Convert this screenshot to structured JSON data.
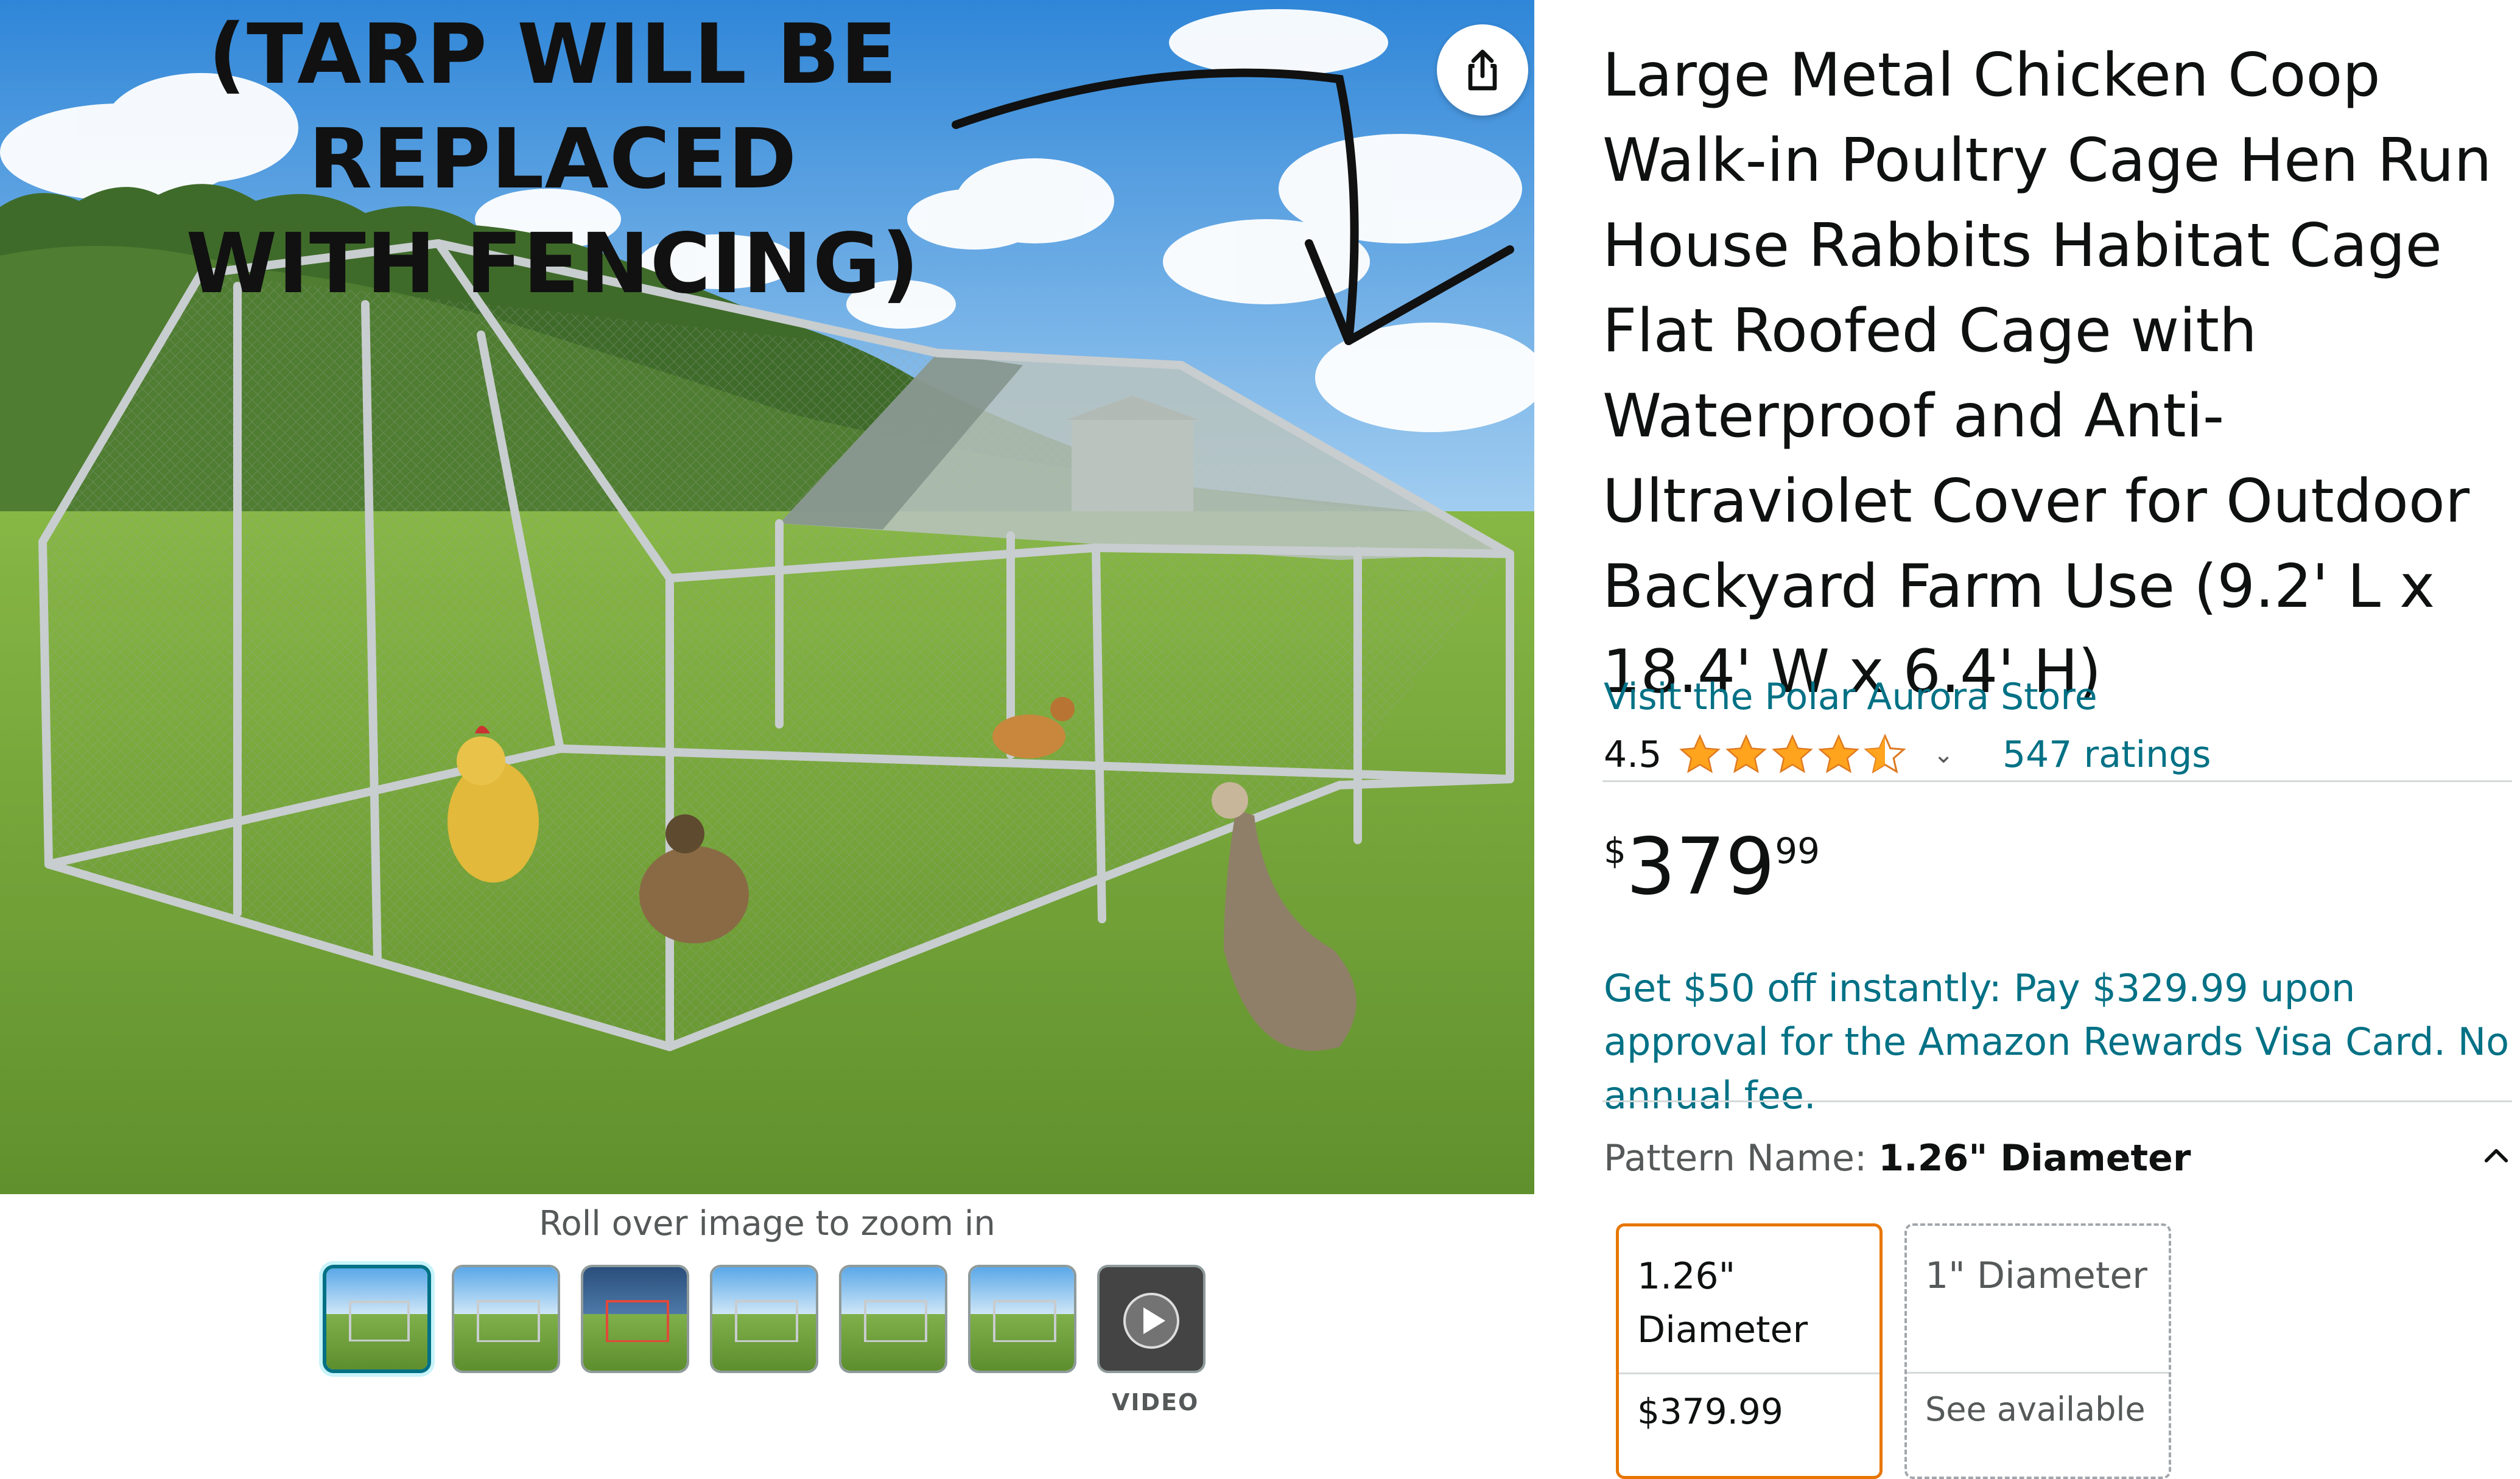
{
  "annotation": {
    "text": "(TARP WILL BE REPLACED\nWITH FENCING)"
  },
  "gallery": {
    "hint": "Roll over image to zoom in",
    "video_label": "VIDEO",
    "thumbnail_count": 7,
    "selected_index": 0
  },
  "product": {
    "title": "Large Metal Chicken Coop Walk-in Poultry Cage Hen Run House Rabbits Habitat Cage Flat Roofed Cage with Waterproof and Anti-Ultraviolet Cover for Outdoor Backyard Farm Use (9.2' L x 18.4' W x 6.4' H)",
    "store_link": "Visit the Polar Aurora Store",
    "rating": "4.5",
    "ratings_count": "547 ratings",
    "price": {
      "symbol": "$",
      "whole": "379",
      "fraction": "99"
    },
    "promo": "Get $50 off instantly: Pay $329.99 upon approval for the Amazon Rewards Visa Card. No annual fee.",
    "pattern": {
      "label": "Pattern Name: ",
      "value": "1.26\" Diameter"
    },
    "options": [
      {
        "name": "1.26\" Diameter",
        "price": "$379.99"
      },
      {
        "name": "1\" Diameter",
        "price": "See available"
      }
    ]
  },
  "colors": {
    "link": "#007185",
    "selected_border": "#e77600",
    "star": "#ffa41c"
  }
}
